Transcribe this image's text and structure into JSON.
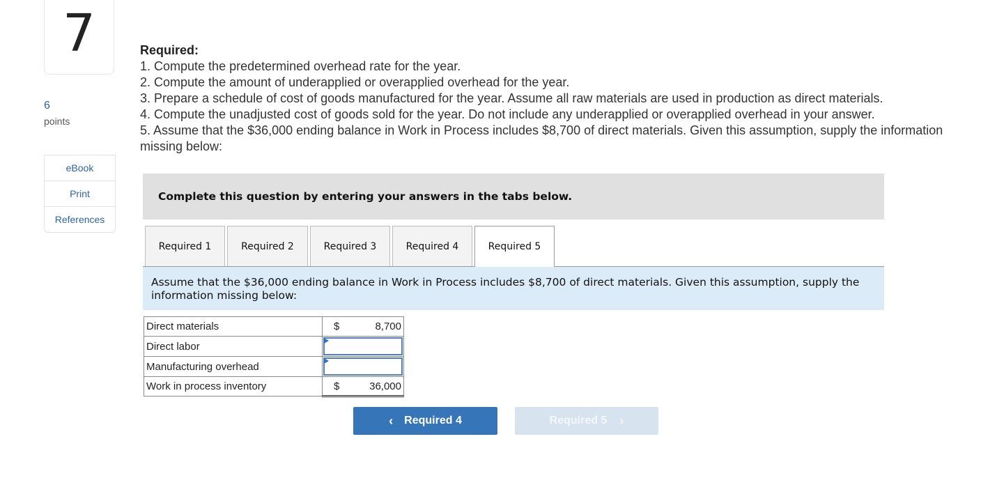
{
  "question": {
    "number": "7",
    "points_value": "6",
    "points_label": "points"
  },
  "sidebar": {
    "links": [
      {
        "label": "eBook"
      },
      {
        "label": "Print"
      },
      {
        "label": "References"
      }
    ]
  },
  "required": {
    "title": "Required:",
    "items": [
      "1. Compute the predetermined overhead rate for the year.",
      "2. Compute the amount of underapplied or overapplied overhead for the year.",
      "3. Prepare a schedule of cost of goods manufactured for the year. Assume all raw materials are used in production as direct materials.",
      "4. Compute the unadjusted cost of goods sold for the year. Do not include any underapplied or overapplied overhead in your answer.",
      "5. Assume that the $36,000 ending balance in Work in Process includes $8,700 of direct materials. Given this assumption, supply the information missing below:"
    ]
  },
  "banner": {
    "text": "Complete this question by entering your answers in the tabs below."
  },
  "tabs": [
    {
      "label": "Required 1",
      "active": false
    },
    {
      "label": "Required 2",
      "active": false
    },
    {
      "label": "Required 3",
      "active": false
    },
    {
      "label": "Required 4",
      "active": false
    },
    {
      "label": "Required 5",
      "active": true
    }
  ],
  "info": {
    "text": "Assume that the $36,000 ending balance in Work in Process includes $8,700 of direct materials. Given this assumption, supply the information missing below:"
  },
  "table": {
    "rows": [
      {
        "label": "Direct materials",
        "currency": "$",
        "value": "8,700"
      },
      {
        "label": "Direct labor",
        "value": "",
        "placeholder": ""
      },
      {
        "label": "Manufacturing overhead",
        "value": "",
        "placeholder": ""
      },
      {
        "label": "Work in process inventory",
        "currency": "$",
        "value": "36,000"
      }
    ]
  },
  "navigation": {
    "prev_label": "Required 4",
    "next_label": "Required 5",
    "prev_icon": "chevron-left-icon",
    "next_icon": "chevron-right-icon",
    "prev_color": "#3775b9",
    "next_color": "#d8e3f0"
  }
}
